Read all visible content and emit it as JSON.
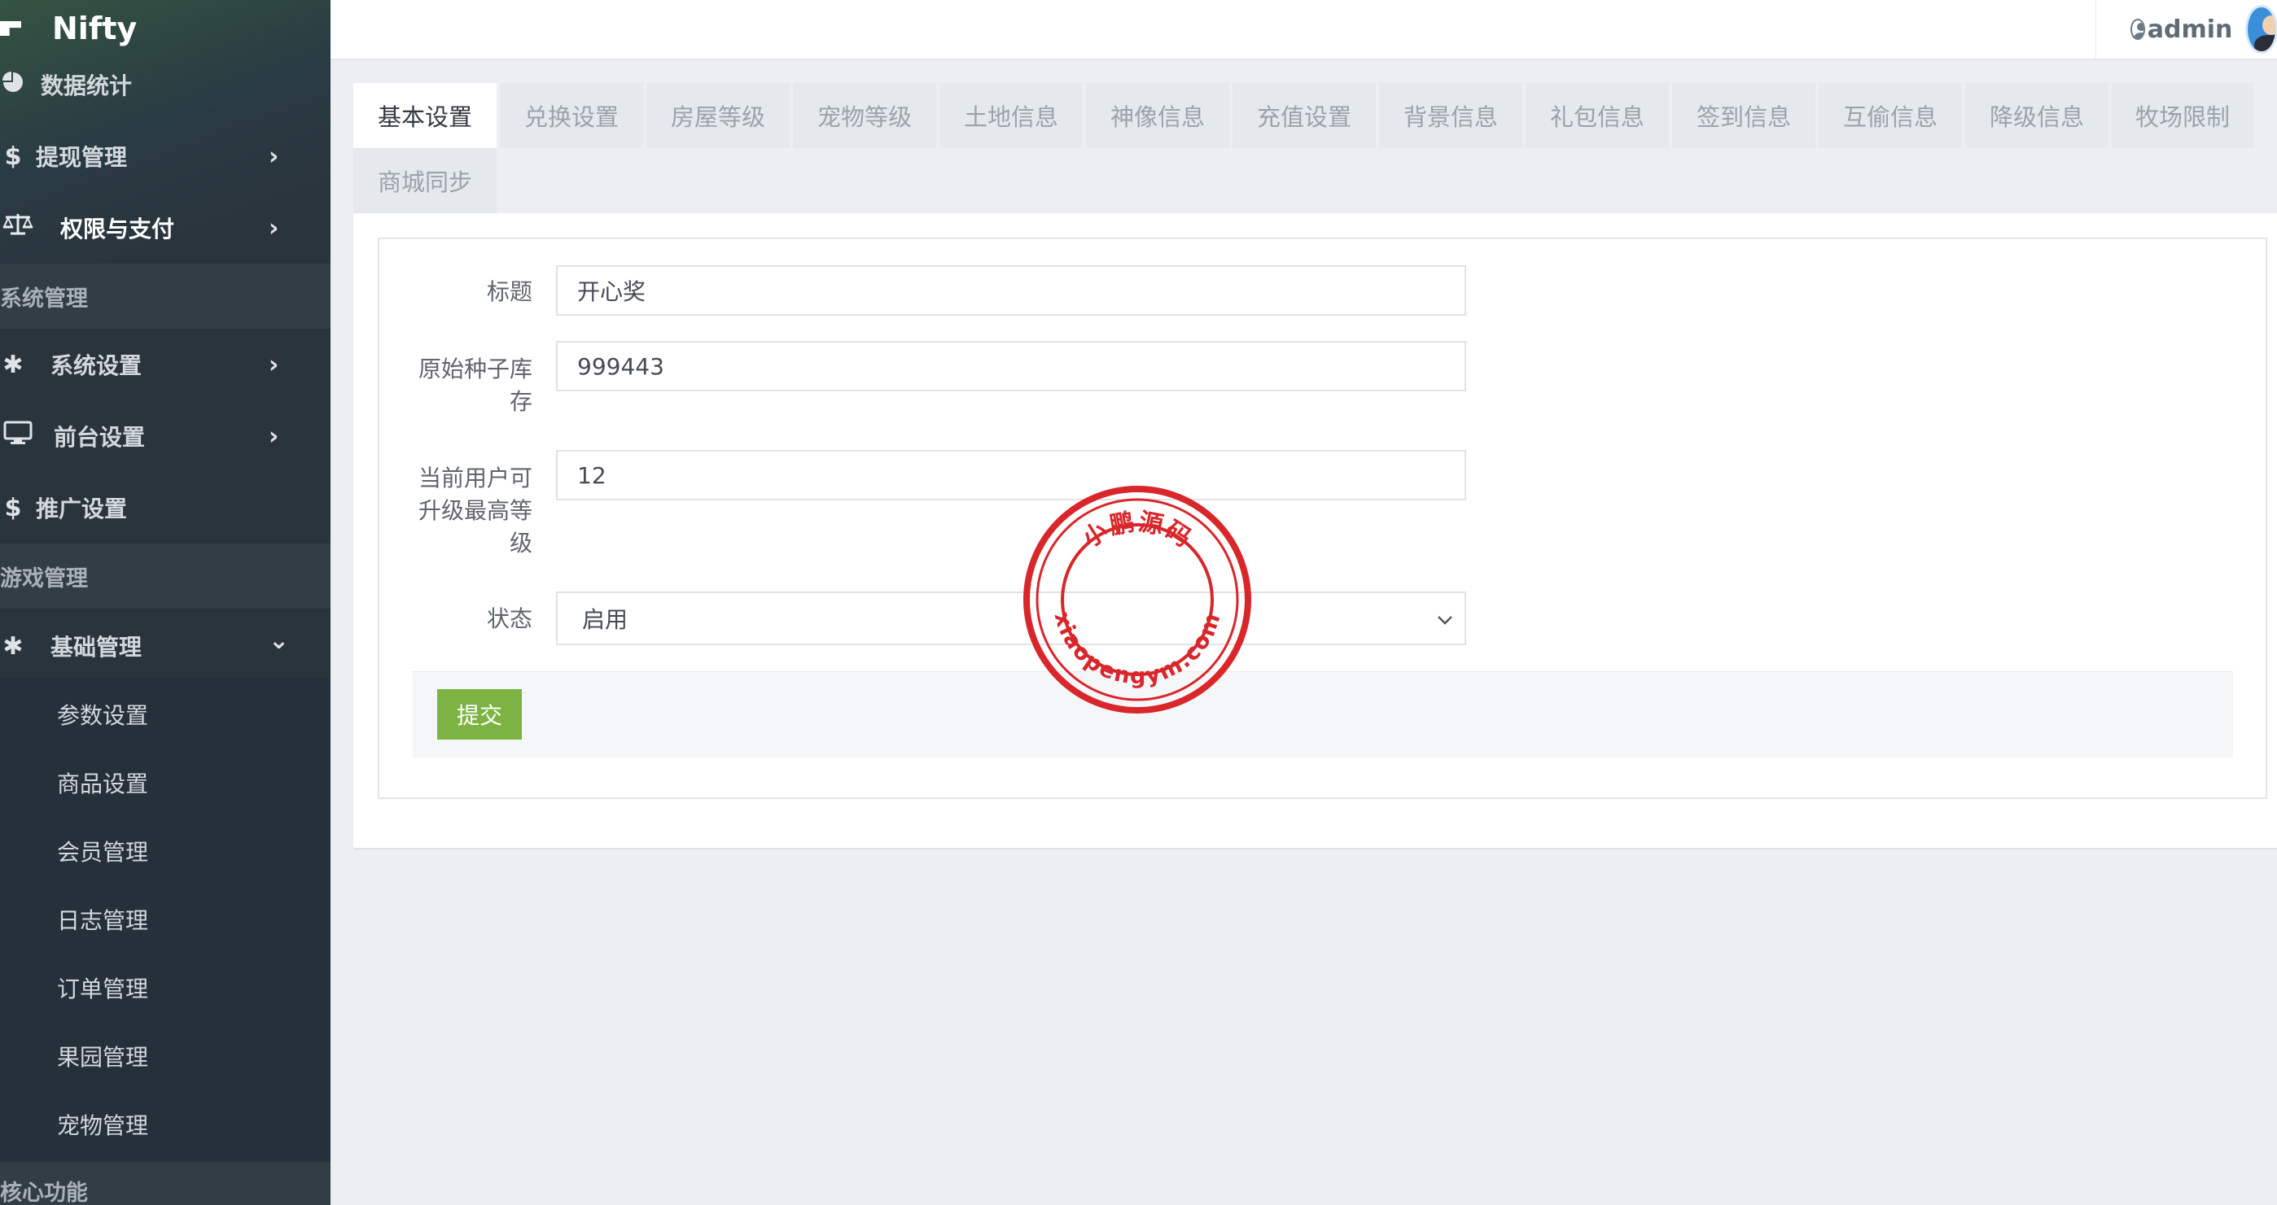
{
  "brand": {
    "name": "Nifty"
  },
  "sidebar": {
    "top_items": [
      {
        "label": "数据统计",
        "icon": "pie-chart-icon",
        "chevron": ""
      },
      {
        "label": "提现管理",
        "icon": "dollar-icon",
        "chevron": "›"
      },
      {
        "label": "权限与支付",
        "icon": "balance-scale-icon",
        "chevron": "›"
      }
    ],
    "section_system": "系统管理",
    "system_items": [
      {
        "label": "系统设置",
        "icon": "gear-icon",
        "chevron": "›"
      },
      {
        "label": "前台设置",
        "icon": "monitor-icon",
        "chevron": "›"
      },
      {
        "label": "推广设置",
        "icon": "dollar-icon",
        "chevron": ""
      }
    ],
    "section_game": "游戏管理",
    "game_item": {
      "label": "基础管理",
      "icon": "gear-icon",
      "chevron": "⌄"
    },
    "sub_items": [
      "参数设置",
      "商品设置",
      "会员管理",
      "日志管理",
      "订单管理",
      "果园管理",
      "宠物管理"
    ],
    "section_core": "核心功能"
  },
  "header": {
    "username": "admin"
  },
  "tabs": [
    "基本设置",
    "兑换设置",
    "房屋等级",
    "宠物等级",
    "土地信息",
    "神像信息",
    "充值设置",
    "背景信息",
    "礼包信息",
    "签到信息",
    "互偷信息",
    "降级信息",
    "牧场限制",
    "商城同步"
  ],
  "form": {
    "title_label": "标题",
    "title_value": "开心奖",
    "stock_label_1": "原始种子库",
    "stock_label_2": "存",
    "stock_value": "999443",
    "level_label_1": "当前用户可",
    "level_label_2": "升级最高等",
    "level_label_3": "级",
    "level_value": "12",
    "status_label": "状态",
    "status_value": "启用",
    "submit_label": "提交"
  },
  "stamp": {
    "text_top": "小鹏源码",
    "text_bottom": "xiaopengym.com",
    "color": "#d9262b"
  }
}
